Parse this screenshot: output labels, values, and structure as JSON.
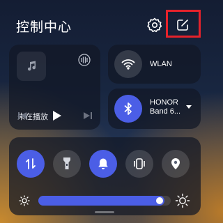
{
  "header": {
    "title": "控制中心"
  },
  "media": {
    "status": "未在播放"
  },
  "wlan": {
    "label": "WLAN"
  },
  "bluetooth": {
    "line1": "HONOR",
    "line2": "Band 6..."
  },
  "brightness": {
    "level": 0.95
  },
  "colors": {
    "accent": "#4b5ee6",
    "highlight_box": "#e5222b"
  }
}
